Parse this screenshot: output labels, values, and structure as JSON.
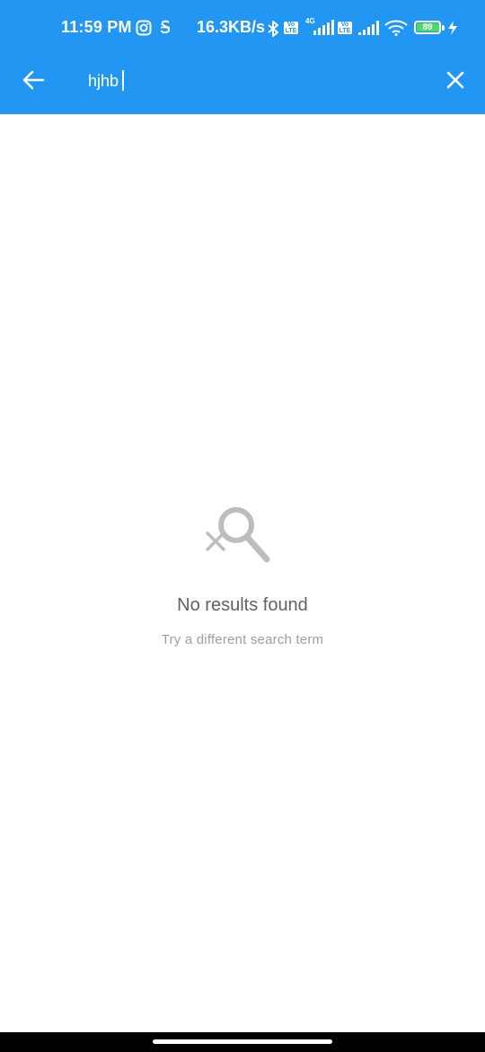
{
  "status_bar": {
    "time": "11:59 PM",
    "speed": "16.3KB/s",
    "network_type": "4G",
    "volte_label": "Vo LTE",
    "battery_level": "89",
    "icons": [
      "instagram-icon",
      "s-app-icon",
      "bluetooth-icon",
      "volte-icon",
      "signal-icon",
      "wifi-icon",
      "battery-icon",
      "charging-icon"
    ]
  },
  "app_bar": {
    "back_icon": "arrow-left-icon",
    "search_value": "hjhb",
    "clear_icon": "close-icon"
  },
  "empty_state": {
    "icon": "search-off-icon",
    "title": "No results found",
    "subtitle": "Try a different search term"
  },
  "colors": {
    "primary": "#2196F3",
    "empty_icon": "#9E9E9E",
    "title_text": "#616161",
    "subtitle_text": "#9E9E9E"
  }
}
